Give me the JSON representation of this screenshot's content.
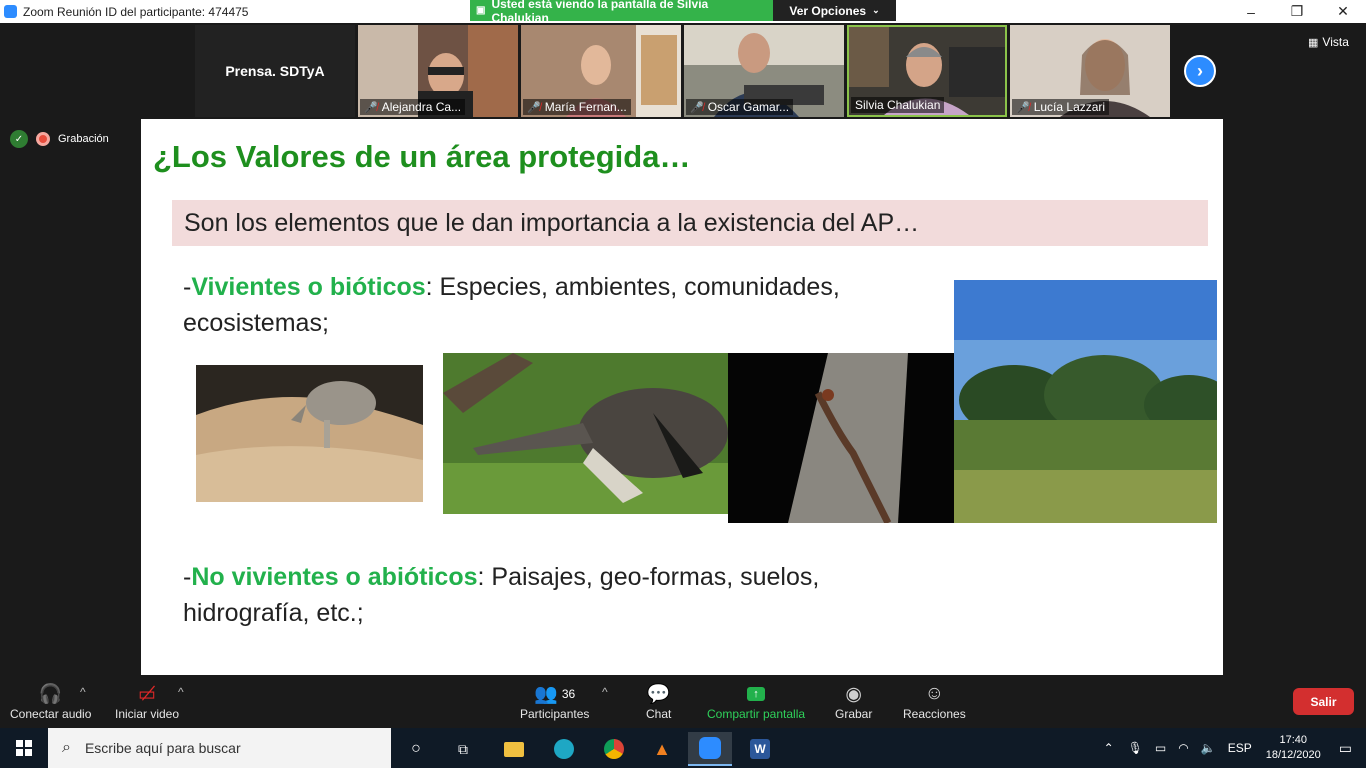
{
  "window": {
    "title": "Zoom Reunión ID del participante: 474475",
    "controls": [
      "–",
      "❐",
      "✕"
    ]
  },
  "share_banner": {
    "text": "Usted está viendo la pantalla de Silvia Chalukian",
    "options_label": "Ver Opciones"
  },
  "gallery": {
    "name_tile": "Prensa. SDTyA",
    "participants": [
      {
        "name": "Alejandra Ca...",
        "muted": true,
        "color": "#7a5a4a"
      },
      {
        "name": "María Fernan...",
        "muted": true,
        "color": "#b8917a"
      },
      {
        "name": "Oscar Gamar...",
        "muted": true,
        "color": "#8a8a7e"
      },
      {
        "name": "Silvia Chalukian",
        "muted": false,
        "color": "#5a4a3a"
      },
      {
        "name": "Lucía Lazzari",
        "muted": true,
        "color": "#c9b5a4"
      }
    ],
    "view_label": "Vista"
  },
  "recording": {
    "label": "Grabación"
  },
  "slide": {
    "title": "¿Los Valores de un área protegida…",
    "subtitle": "Son los elementos que le dan importancia a la existencia del AP…",
    "biotic_prefix": "-",
    "biotic_highlight": "Vivientes o bióticos",
    "biotic_text": ": Especies, ambientes, comunidades,",
    "biotic_text2": "ecosistemas;",
    "abiotic_prefix": "-",
    "abiotic_highlight": "No vivientes o abióticos",
    "abiotic_text": ": Paisajes, geo-formas, suelos,",
    "abiotic_text2": "hidrografía, etc.;"
  },
  "toolbar": {
    "audio": "Conectar audio",
    "video": "Iniciar video",
    "participants": "Participantes",
    "participants_count": "36",
    "chat": "Chat",
    "share": "Compartir pantalla",
    "record": "Grabar",
    "reactions": "Reacciones",
    "leave": "Salir"
  },
  "taskbar": {
    "search_placeholder": "Escribe aquí para buscar",
    "language": "ESP",
    "time": "17:40",
    "date": "18/12/2020"
  }
}
